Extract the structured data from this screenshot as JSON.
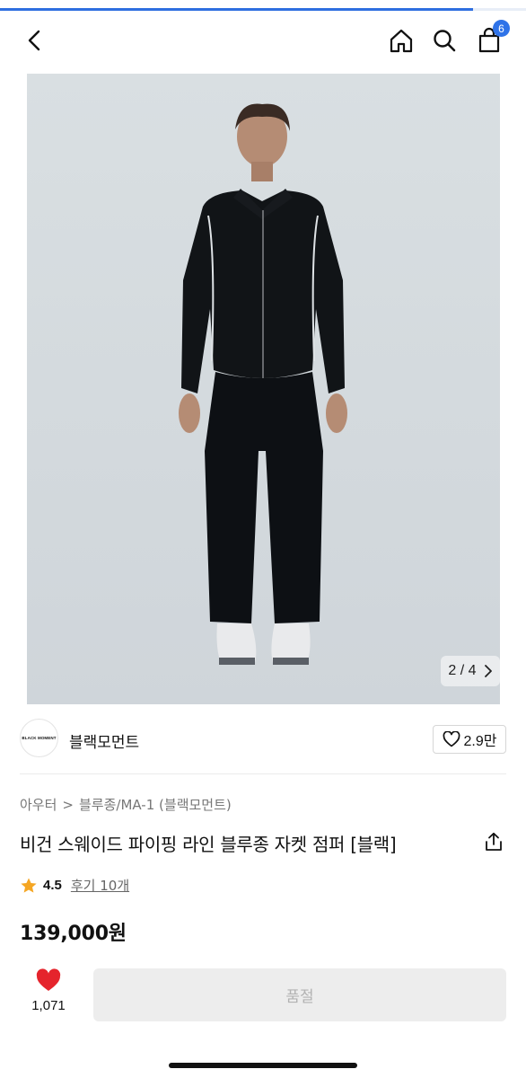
{
  "load_progress": 0.9,
  "header": {
    "back_icon": "chevron-left-icon",
    "home_icon": "home-icon",
    "search_icon": "search-icon",
    "cart_icon": "shopping-bag-icon",
    "cart_count": "6"
  },
  "gallery": {
    "pager_current": "2",
    "pager_sep": "/",
    "pager_total": "4",
    "pager_next_icon": "chevron-right-icon"
  },
  "brand": {
    "logo_text": "BLACK MOMENT",
    "name": "블랙모먼트",
    "like_icon": "heart-outline-icon",
    "like_count": "2.9만"
  },
  "breadcrumb": {
    "category": "아우터",
    "separator": ">",
    "subcategory": "블루종/MA-1 (블랙모먼트)"
  },
  "product": {
    "title": "비건 스웨이드 파이핑 라인 블루종 자켓 점퍼 [블랙]",
    "share_icon": "share-icon",
    "rating": "4.5",
    "review_label": "후기 10개",
    "price": "139,000원"
  },
  "bottom_bar": {
    "wish_count": "1,071",
    "soldout_label": "품절"
  },
  "colors": {
    "accent": "#2f73e8",
    "heart": "#e5242c",
    "star": "#f5a623"
  }
}
